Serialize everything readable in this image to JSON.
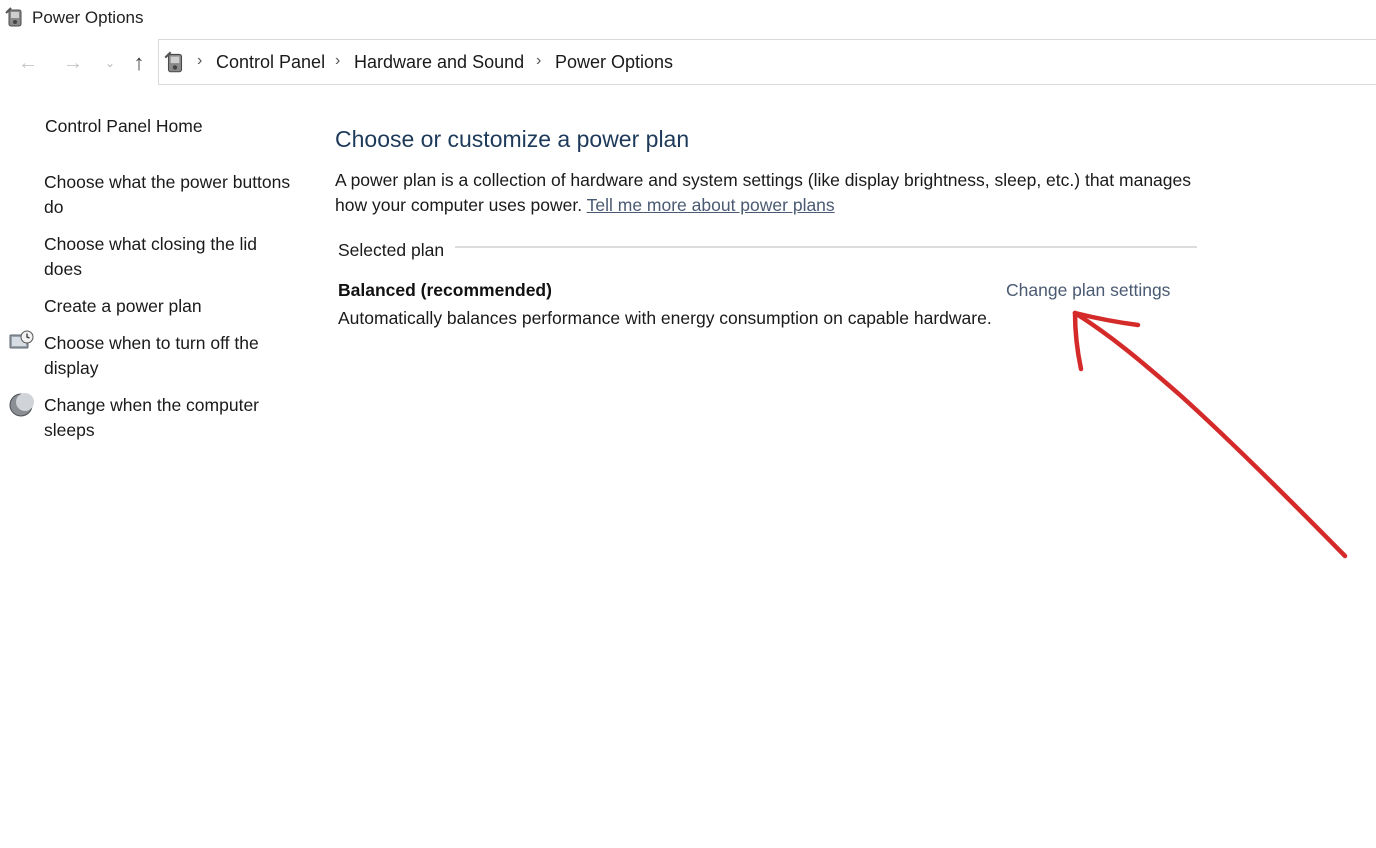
{
  "window": {
    "title": "Power Options",
    "icon": "power-options-icon"
  },
  "nav": {
    "back_icon": "back-arrow-icon",
    "forward_icon": "forward-arrow-icon",
    "recent_icon": "chevron-down-icon",
    "up_icon": "up-arrow-icon",
    "breadcrumbs": [
      "Control Panel",
      "Hardware and Sound",
      "Power Options"
    ]
  },
  "sidebar": {
    "home": "Control Panel Home",
    "links": [
      {
        "label": "Choose what the power buttons do",
        "icon": ""
      },
      {
        "label": "Choose what closing the lid does",
        "icon": ""
      },
      {
        "label": "Create a power plan",
        "icon": ""
      },
      {
        "label": "Choose when to turn off the display",
        "icon": "display-clock-icon"
      },
      {
        "label": "Change when the computer sleeps",
        "icon": "moon-icon"
      }
    ]
  },
  "main": {
    "heading": "Choose or customize a power plan",
    "description": "A power plan is a collection of hardware and system settings (like display brightness, sleep, etc.) that manages how your computer uses power.",
    "description_link": "Tell me more about power plans",
    "group_label": "Selected plan",
    "plan": {
      "name": "Balanced (recommended)",
      "settings_link": "Change plan settings",
      "description": "Automatically balances performance with energy consumption on capable hardware."
    }
  },
  "annotation": {
    "type": "hand-drawn arrow",
    "color": "#d42a2a",
    "points_to": "Change plan settings"
  }
}
